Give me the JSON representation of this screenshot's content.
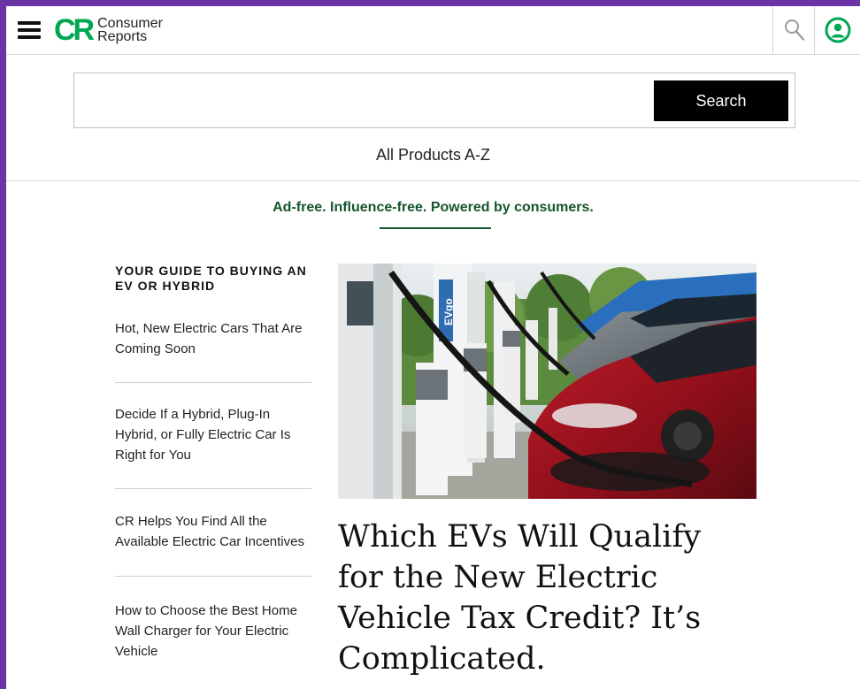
{
  "header": {
    "logo_mark": "CR",
    "logo_line1": "Consumer",
    "logo_line2": "Reports"
  },
  "search": {
    "value": "",
    "placeholder": "",
    "button_label": "Search",
    "all_products_link": "All Products A-Z"
  },
  "tagline": "Ad-free. Influence-free. Powered by consumers.",
  "guide": {
    "title": "YOUR GUIDE TO BUYING AN EV OR HYBRID",
    "items": [
      {
        "label": "Hot, New Electric Cars That Are Coming Soon"
      },
      {
        "label": "Decide If a Hybrid, Plug-In Hybrid, or Fully Electric Car Is Right for You"
      },
      {
        "label": "CR Helps You Find All the Available Electric Car Incentives"
      },
      {
        "label": "How to Choose the Best Home Wall Charger for Your Electric Vehicle"
      }
    ]
  },
  "article": {
    "headline": "Which EVs Will Qualify for the New Electric Vehicle Tax Credit? It’s Complicated.",
    "image_charger_brand": "EVgo"
  },
  "colors": {
    "brand_green": "#00a651",
    "tagline_green": "#16562f",
    "window_border": "#6b35a7"
  },
  "icons": {
    "menu": "hamburger-menu-icon",
    "search": "search-icon",
    "account": "account-icon"
  }
}
